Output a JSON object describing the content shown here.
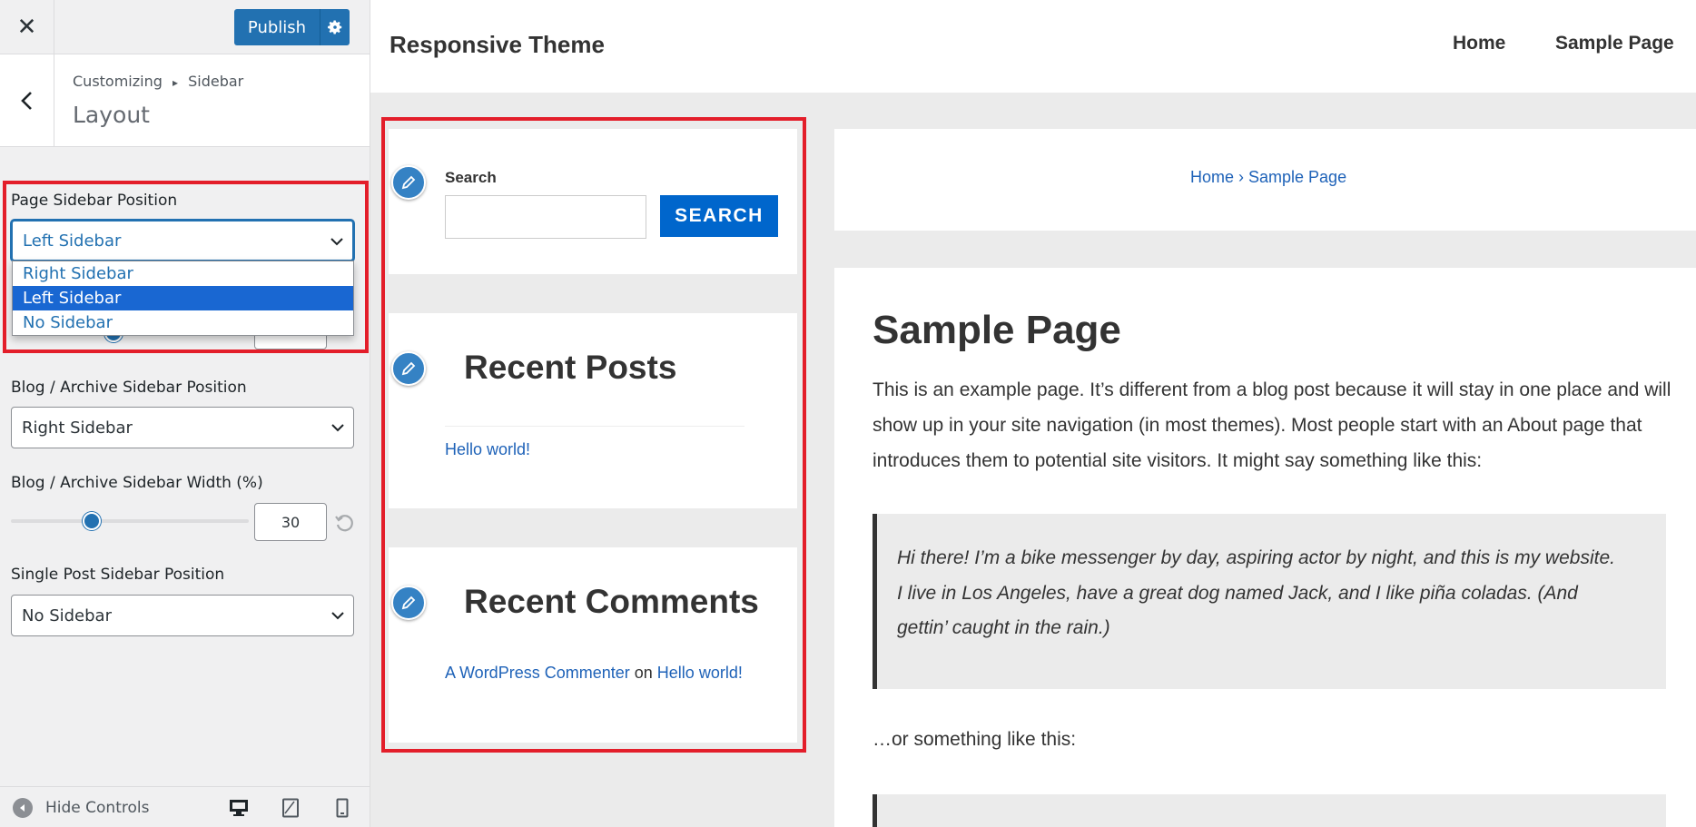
{
  "customizer": {
    "publish_label": "Publish",
    "breadcrumb": {
      "root": "Customizing",
      "separator": "▸",
      "section": "Sidebar"
    },
    "section_title": "Layout",
    "controls": {
      "page_sidebar_position": {
        "label": "Page Sidebar Position",
        "value": "Left Sidebar",
        "options": [
          "Right Sidebar",
          "Left Sidebar",
          "No Sidebar"
        ]
      },
      "blog_archive_sidebar_position": {
        "label": "Blog / Archive Sidebar Position",
        "value": "Right Sidebar"
      },
      "blog_archive_sidebar_width": {
        "label": "Blog / Archive Sidebar Width (%)",
        "value": "30"
      },
      "single_post_sidebar_position": {
        "label": "Single Post Sidebar Position",
        "value": "No Sidebar"
      }
    },
    "footer": {
      "hide_controls_label": "Hide Controls"
    }
  },
  "preview": {
    "site_title": "Responsive Theme",
    "nav": [
      "Home",
      "Sample Page"
    ],
    "sidebar": {
      "search_widget": {
        "label": "Search",
        "button_label": "SEARCH"
      },
      "recent_posts": {
        "title": "Recent Posts",
        "items": [
          "Hello world!"
        ]
      },
      "recent_comments": {
        "title": "Recent Comments",
        "author": "A WordPress Commenter",
        "connector": "on",
        "post": "Hello world!"
      }
    },
    "breadcrumb": "Home › Sample Page",
    "page": {
      "title": "Sample Page",
      "intro": "This is an example page. It’s different from a blog post because it will stay in one place and will show up in your site navigation (in most themes). Most people start with an About page that introduces them to potential site visitors. It might say something like this:",
      "quote_1": "Hi there! I’m a bike messenger by day, aspiring actor by night, and this is my website. I live in Los Angeles, have a great dog named Jack, and I like piña coladas. (And gettin’ caught in the rain.)",
      "or_text": "…or something like this:"
    }
  },
  "colors": {
    "accent": "#2271b1",
    "highlight": "#e31e2a",
    "link": "#1e62b8",
    "search_button": "#0066cc"
  }
}
